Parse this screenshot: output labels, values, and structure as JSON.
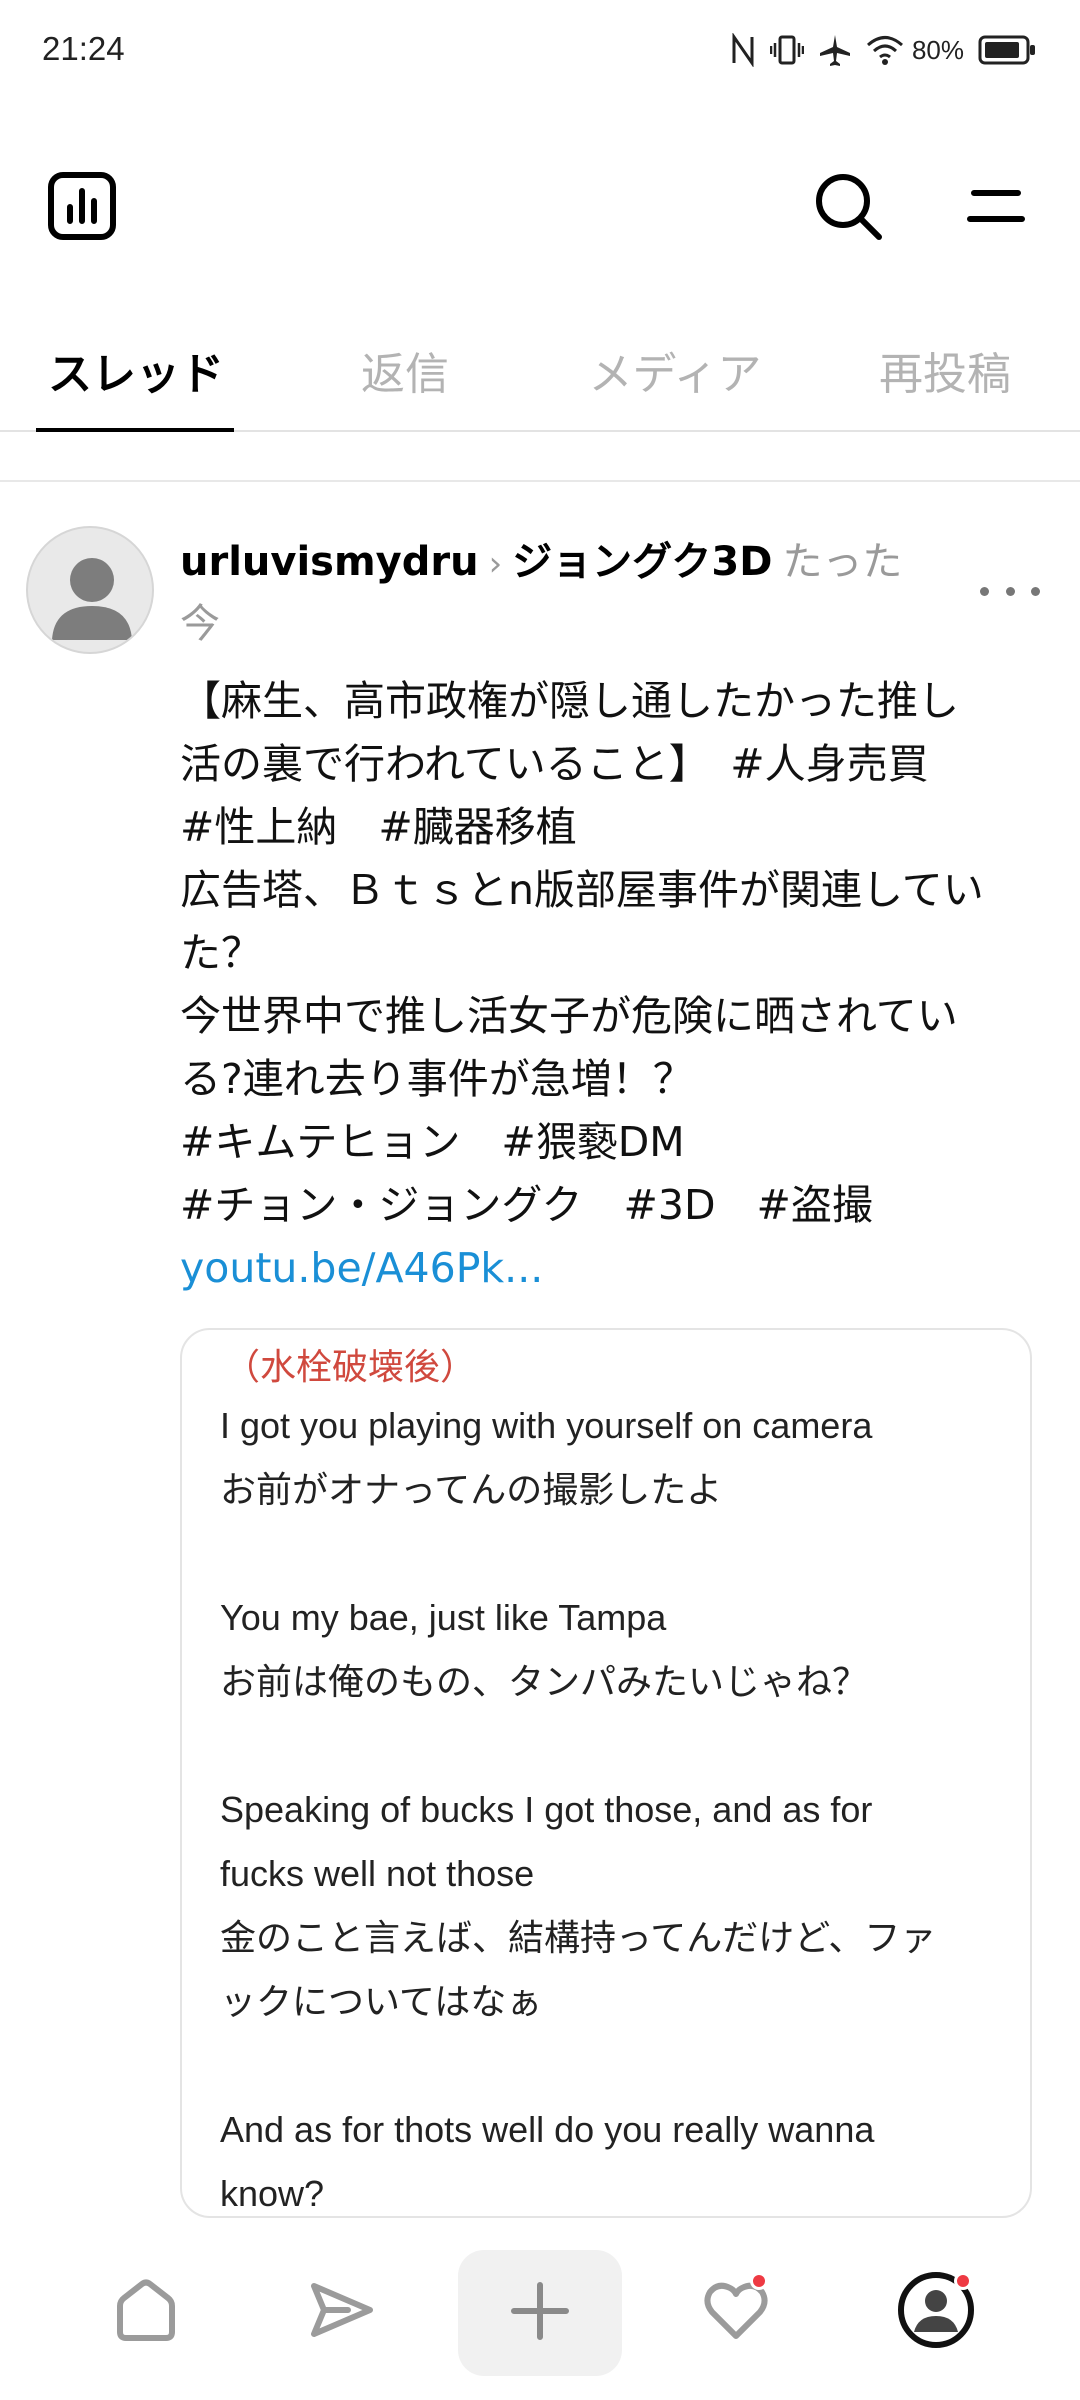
{
  "status_bar": {
    "time": "21:24",
    "battery": "80%",
    "icons": [
      "nfc-icon",
      "vibrate-icon",
      "airplane-icon",
      "wifi-icon",
      "battery-icon"
    ]
  },
  "app_bar": {
    "icons": [
      "insights-icon",
      "search-icon",
      "menu-icon"
    ]
  },
  "tabs": [
    {
      "label": "スレッド",
      "active": true
    },
    {
      "label": "返信",
      "active": false
    },
    {
      "label": "メディア",
      "active": false
    },
    {
      "label": "再投稿",
      "active": false
    }
  ],
  "post": {
    "username": "urluvismydru",
    "separator": "›",
    "community": "ジョングク3D",
    "time_ago_1": "たった",
    "time_ago_2": "今",
    "body_lines": [
      "【麻生、高市政権が隠し通したかった推し",
      "活の裏で行われていること】　#人身売買",
      "#性上納　#臓器移植",
      "広告塔、Ｂｔｓとn版部屋事件が関連してい",
      "た？",
      "今世界中で推し活女子が危険に晒されてい",
      "る?連れ去り事件が急増！？",
      "#キムテヒョン　#猥褻DM",
      "#チョン・ジョングク　#3D　#盗撮"
    ],
    "link": "youtu.be/A46Pk..."
  },
  "card": {
    "title": "（水栓破壊後）",
    "lines": [
      "I got you playing with yourself on camera",
      "お前がオナってんの撮影したよ",
      "",
      "You my bae, just like Tampa",
      "お前は俺のもの、タンパみたいじゃね？",
      "",
      "Speaking of bucks I got those, and as for",
      "fucks well not those",
      "金のこと言えば、結構持ってんだけど、ファ",
      "ックについてはなぁ",
      "",
      "And as for thots well do you really wanna",
      "know?"
    ]
  },
  "bottom_nav": {
    "items": [
      "home-icon",
      "send-icon",
      "plus-icon",
      "heart-icon",
      "profile-icon"
    ],
    "accent": "#ee3a43"
  },
  "colors": {
    "link": "#1a8fd6",
    "card_title": "#d0493e",
    "muted": "#9a9a9a"
  }
}
